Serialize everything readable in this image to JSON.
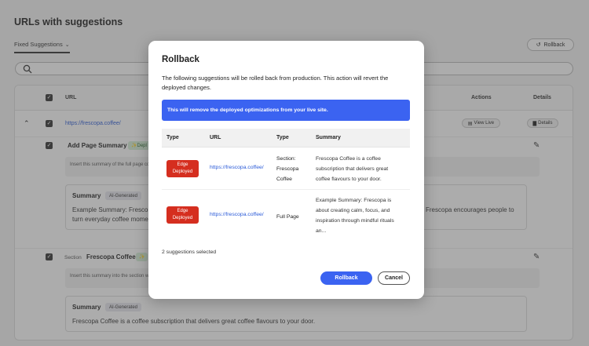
{
  "page": {
    "title": "URLs with suggestions",
    "filter_label": "Fixed Suggestions",
    "rollback_label": "Rollback"
  },
  "table": {
    "headers": {
      "url": "URL",
      "actions": "Actions",
      "details": "Details"
    },
    "url_row": {
      "url": "https://frescopa.coffee/",
      "view_live": "View Live",
      "details": "Details"
    },
    "suggestions": [
      {
        "title": "Add Page Summary",
        "tag": "Depl",
        "hint": "Insert this summary of the full page co",
        "summary_label": "Summary",
        "ai_badge": "AI-Generated",
        "summary_text_left": "Example Summary: Frescop",
        "summary_text_left2": "turn everyday coffee mome",
        "summary_text_right": "Frescopa encourages people to"
      },
      {
        "section_label": "Section",
        "title": "Frescopa Coffee",
        "hint": "Insert this summary into the section w",
        "summary_label": "Summary",
        "ai_badge": "AI-Generated",
        "summary_text": "Frescopa Coffee is a coffee subscription that delivers great coffee flavours to your door."
      }
    ]
  },
  "modal": {
    "title": "Rollback",
    "description": "The following suggestions will be rolled back from production. This action will revert the deployed changes.",
    "banner": "This will remove the deployed optimizations from your live site.",
    "table_headers": {
      "type": "Type",
      "url": "URL",
      "type2": "Type",
      "summary": "Summary"
    },
    "rows": [
      {
        "badge_line1": "Edge",
        "badge_line2": "Deployed",
        "url": "https://frescopa.coffee/",
        "type_line1": "Section:",
        "type_line2": "Frescopa",
        "type_line3": "Coffee",
        "summary_line1": "Frescopa Coffee is a coffee",
        "summary_line2": "subscription that delivers great",
        "summary_line3": "coffee flavours to your door."
      },
      {
        "badge_line1": "Edge",
        "badge_line2": "Deployed",
        "url": "https://frescopa.coffee/",
        "type_line1": "Full Page",
        "summary_line1": "Example Summary: Frescopa is",
        "summary_line2": "about creating calm, focus, and",
        "summary_line3": "inspiration through mindful rituals",
        "summary_line4": "an..."
      }
    ],
    "selected_count": "2 suggestions selected",
    "confirm_label": "Rollback",
    "cancel_label": "Cancel"
  },
  "colors": {
    "primary": "#3b63f1",
    "danger": "#d52e1f",
    "link": "#2b5bd8"
  }
}
